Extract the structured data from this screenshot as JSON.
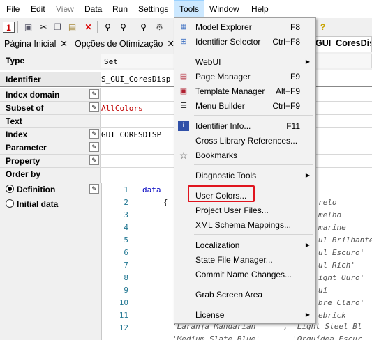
{
  "menubar": {
    "items": [
      "File",
      "Edit",
      "View",
      "Data",
      "Run",
      "Settings",
      "Tools",
      "Window",
      "Help"
    ]
  },
  "tabs": [
    {
      "label": "Página Inicial",
      "close": "✕"
    },
    {
      "label": "Opções de Otimização",
      "close": "✕"
    },
    {
      "label": "GUI_CoresDispo"
    }
  ],
  "properties": {
    "type_label": "Type",
    "type_value": "Set",
    "identifier_label": "Identifier",
    "identifier_value": "S_GUI_CoresDisp",
    "index_domain_label": "Index domain",
    "subset_of_label": "Subset of",
    "subset_of_value": "AllColors",
    "text_label": "Text",
    "index_label": "Index",
    "index_value": "GUI_CORESDISP",
    "parameter_label": "Parameter",
    "property_label": "Property",
    "order_by_label": "Order by",
    "definition_label": "Definition",
    "initial_data_label": "Initial data"
  },
  "code": {
    "line_numbers": [
      "1",
      "2",
      "3",
      "4",
      "5",
      "6",
      "7",
      "8",
      "9",
      "10",
      "11",
      "12"
    ],
    "lines": [
      "data",
      "   {",
      "",
      "",
      "",
      "",
      "",
      "",
      "",
      "",
      "",
      ""
    ],
    "right_fragments": [
      "relo",
      "melho",
      "marine",
      "ul Brilhante'",
      "ul Escuro'",
      "ul Rich'",
      "ight Ouro'",
      "ui",
      "bre Claro'",
      "ebrick",
      "'Laranja Mandarian'     , 'Light Steel Bl",
      "'Medium Slate Blue'     , 'Orquídea Escur"
    ]
  },
  "tools_menu": {
    "items": [
      {
        "label": "Model Explorer",
        "shortcut": "F8",
        "icon": "model-explorer-icon"
      },
      {
        "label": "Identifier Selector",
        "shortcut": "Ctrl+F8",
        "icon": "identifier-selector-icon"
      },
      {
        "label": "WebUI",
        "submenu": true
      },
      {
        "label": "Page Manager",
        "shortcut": "F9",
        "icon": "page-manager-icon"
      },
      {
        "label": "Template Manager",
        "shortcut": "Alt+F9",
        "icon": "template-manager-icon"
      },
      {
        "label": "Menu Builder",
        "shortcut": "Ctrl+F9",
        "icon": "menu-builder-icon"
      },
      {
        "label": "Identifier Info...",
        "shortcut": "F11",
        "icon": "info-icon"
      },
      {
        "label": "Cross Library References..."
      },
      {
        "label": "Bookmarks",
        "icon": "star-icon"
      },
      {
        "label": "Diagnostic Tools",
        "submenu": true
      },
      {
        "label": "User Colors..."
      },
      {
        "label": "Project User Files..."
      },
      {
        "label": "XML Schema Mappings..."
      },
      {
        "label": "Localization",
        "submenu": true
      },
      {
        "label": "State File Manager..."
      },
      {
        "label": "Commit Name Changes..."
      },
      {
        "label": "Grab Screen Area"
      },
      {
        "label": "License",
        "submenu": true
      }
    ],
    "submenu_arrow": "▶"
  },
  "colors": {
    "menu_highlight": "#cce8ff",
    "callout_red": "#e0141e",
    "subset_text": "#c00000",
    "keyword_blue": "#0000c0"
  }
}
